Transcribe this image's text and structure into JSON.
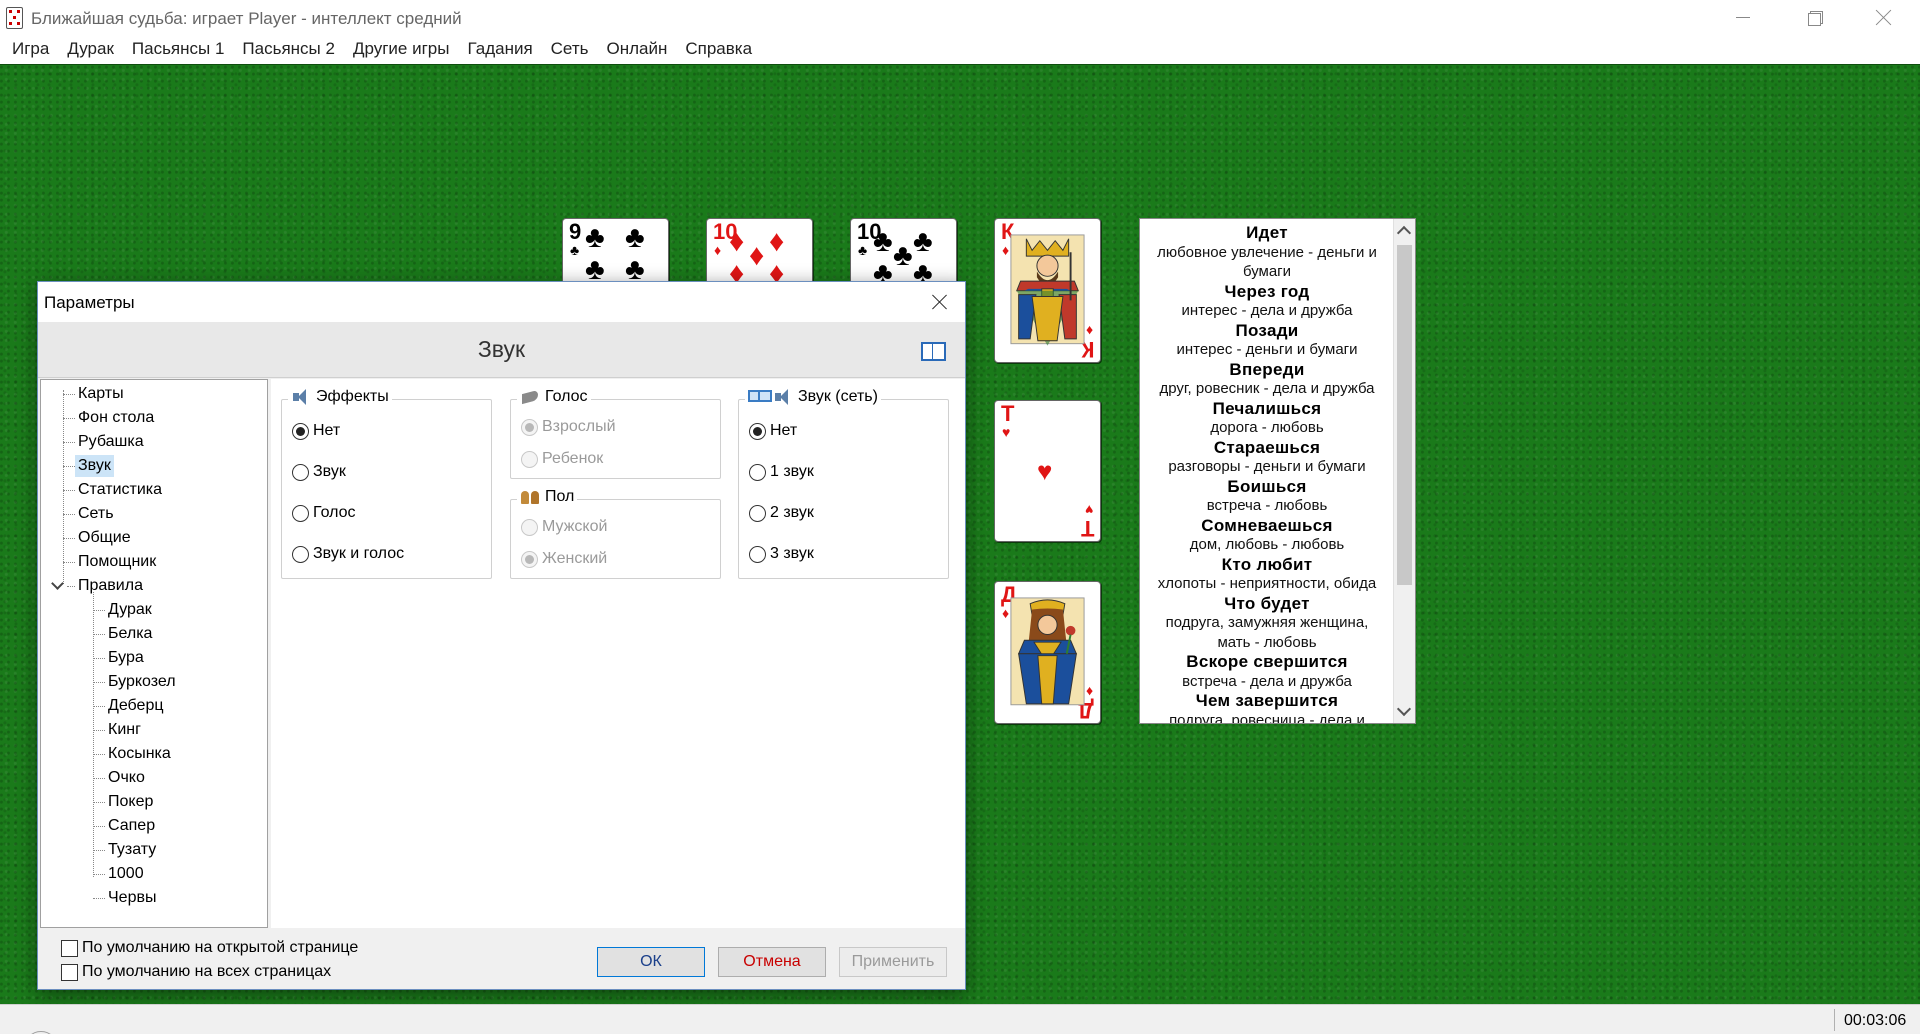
{
  "window": {
    "title": "Ближайшая судьба: играет Player - интеллект средний"
  },
  "menu": [
    "Игра",
    "Дурак",
    "Пасьянсы 1",
    "Пасьянсы 2",
    "Другие игры",
    "Гадания",
    "Сеть",
    "Онлайн",
    "Справка"
  ],
  "cards": [
    {
      "rank": "9",
      "suit": "♣",
      "color": "black"
    },
    {
      "rank": "10",
      "suit": "♦",
      "color": "red"
    },
    {
      "rank": "10",
      "suit": "♣",
      "color": "black"
    },
    {
      "rank": "К",
      "suit": "♦",
      "color": "red"
    },
    {
      "rank": "Т",
      "suit": "♥",
      "color": "red"
    },
    {
      "rank": "Д",
      "suit": "♦",
      "color": "red"
    }
  ],
  "fortune": [
    {
      "head": "Идет",
      "text": [
        "любовное увлечение - деньги и",
        "бумаги"
      ]
    },
    {
      "head": "Через год",
      "text": [
        "интерес - дела и дружба"
      ]
    },
    {
      "head": "Позади",
      "text": [
        "интерес - деньги и бумаги"
      ]
    },
    {
      "head": "Впереди",
      "text": [
        "друг, ровесник - дела и дружба"
      ]
    },
    {
      "head": "Печалишься",
      "text": [
        "дорога - любовь"
      ]
    },
    {
      "head": "Стараешься",
      "text": [
        "разговоры - деньги и бумаги"
      ]
    },
    {
      "head": "Боишься",
      "text": [
        "встреча - любовь"
      ]
    },
    {
      "head": "Сомневаешься",
      "text": [
        "дом, любовь - любовь"
      ]
    },
    {
      "head": "Кто любит",
      "text": [
        "хлопоты - неприятности, обида"
      ]
    },
    {
      "head": "Что будет",
      "text": [
        "подруга, замужняя женщина,",
        "мать - любовь"
      ]
    },
    {
      "head": "Вскоре свершится",
      "text": [
        "встреча - дела и дружба"
      ]
    },
    {
      "head": "Чем завершится",
      "text": [
        "подруга, ровесница - дела и"
      ]
    }
  ],
  "dialog": {
    "title": "Параметры",
    "header": "Звук",
    "tree": [
      "Карты",
      "Фон стола",
      "Рубашка",
      "Звук",
      "Статистика",
      "Сеть",
      "Общие",
      "Помощник",
      "Правила"
    ],
    "tree_rules": [
      "Дурак",
      "Белка",
      "Бура",
      "Буркозел",
      "Деберц",
      "Кинг",
      "Косынка",
      "Очко",
      "Покер",
      "Сапер",
      "Тузату",
      "1000",
      "Червы"
    ],
    "selected_tree_item": "Звук",
    "effects": {
      "title": "Эффекты",
      "options": [
        "Нет",
        "Звук",
        "Голос",
        "Звук и голос"
      ],
      "selected": "Нет"
    },
    "voice": {
      "title": "Голос",
      "options": [
        "Взрослый",
        "Ребенок"
      ],
      "selected": "Взрослый"
    },
    "gender": {
      "title": "Пол",
      "options": [
        "Мужской",
        "Женский"
      ],
      "selected": "Женский"
    },
    "net_sound": {
      "title": "Звук (сеть)",
      "options": [
        "Нет",
        "1 звук",
        "2 звук",
        "3 звук"
      ],
      "selected": "Нет"
    },
    "checkbox_open_page": "По умолчанию на открытой странице",
    "checkbox_all_pages": "По умолчанию на всех страницах",
    "ok": "ОК",
    "cancel": "Отмена",
    "apply": "Применить"
  },
  "status": {
    "time": "00:03:06"
  }
}
